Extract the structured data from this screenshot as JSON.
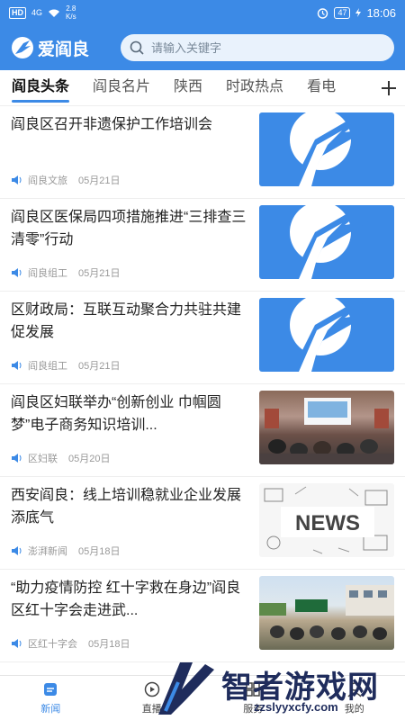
{
  "statusbar": {
    "hd": "HD",
    "signal": "4G",
    "speed_value": "2.8",
    "speed_unit": "K/s",
    "battery": "47",
    "time": "18:06"
  },
  "header": {
    "app_name": "爱阎良",
    "search_placeholder": "请输入关键字"
  },
  "tabs": [
    {
      "label": "阎良头条",
      "active": true
    },
    {
      "label": "阎良名片"
    },
    {
      "label": "陕西"
    },
    {
      "label": "时政热点"
    },
    {
      "label": "看电"
    }
  ],
  "news": [
    {
      "title": "阎良区召开非遗保护工作培训会",
      "source": "阎良文旅",
      "date": "05月21日",
      "thumb": "logo"
    },
    {
      "title": "阎良区医保局四项措施推进“三排查三清零”行动",
      "source": "阎良组工",
      "date": "05月21日",
      "thumb": "logo"
    },
    {
      "title": "区财政局：互联互动聚合力共驻共建促发展",
      "source": "阎良组工",
      "date": "05月21日",
      "thumb": "logo"
    },
    {
      "title": "阎良区妇联举办“创新创业 巾帼圆梦”电子商务知识培训...",
      "source": "区妇联",
      "date": "05月20日",
      "thumb": "photo1"
    },
    {
      "title": "西安阎良：线上培训稳就业企业发展添底气",
      "source": "澎湃新闻",
      "date": "05月18日",
      "thumb": "news"
    },
    {
      "title": "“助力疫情防控 红十字救在身边”阎良区红十字会走进武...",
      "source": "区红十字会",
      "date": "05月18日",
      "thumb": "photo2"
    }
  ],
  "thumb_news_text": "NEWS",
  "bottomnav": [
    {
      "label": "新闻",
      "icon": "news-icon",
      "active": true
    },
    {
      "label": "直播",
      "icon": "live-icon"
    },
    {
      "label": "服务",
      "icon": "service-icon"
    },
    {
      "label": "我的",
      "icon": "profile-icon"
    }
  ],
  "watermark": {
    "text": "智者游戏网",
    "url": "zzslyyxcfy.com"
  },
  "colors": {
    "brand": "#3c8ae6"
  }
}
